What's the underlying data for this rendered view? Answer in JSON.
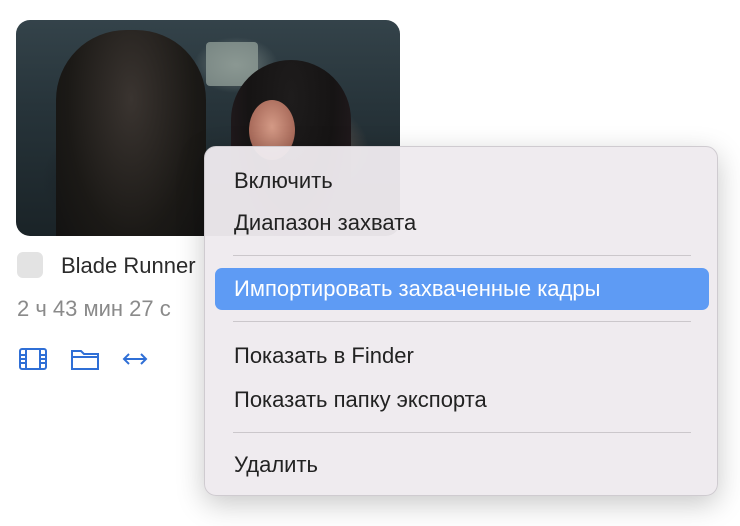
{
  "item": {
    "title": "Blade Runner",
    "duration": "2 ч 43 мин 27 с"
  },
  "toolbar": {
    "icons": [
      "film-icon",
      "folder-icon",
      "swap-horizontal-icon"
    ],
    "accent": "#2f6fd6"
  },
  "context_menu": {
    "highlight_color": "#5e9bf4",
    "group1": [
      "Включить",
      "Диапазон захвата"
    ],
    "group2": [
      "Импортировать захваченные кадры"
    ],
    "group3": [
      "Показать в Finder",
      "Показать папку экспорта"
    ],
    "group4": [
      "Удалить"
    ]
  }
}
